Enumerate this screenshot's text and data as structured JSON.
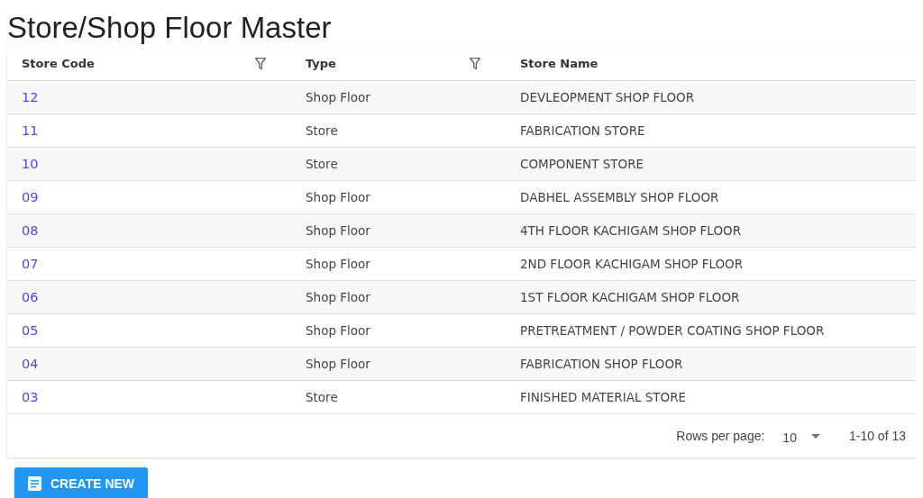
{
  "title": "Store/Shop Floor Master",
  "table": {
    "columns": [
      {
        "label": "Store Code",
        "filter": true
      },
      {
        "label": "Type",
        "filter": true
      },
      {
        "label": "Store Name"
      }
    ],
    "rows": [
      {
        "code": "12",
        "type": "Shop Floor",
        "name": "DEVLEOPMENT SHOP FLOOR"
      },
      {
        "code": "11",
        "type": "Store",
        "name": "FABRICATION STORE"
      },
      {
        "code": "10",
        "type": "Store",
        "name": "COMPONENT STORE"
      },
      {
        "code": "09",
        "type": "Shop Floor",
        "name": "DABHEL ASSEMBLY SHOP FLOOR"
      },
      {
        "code": "08",
        "type": "Shop Floor",
        "name": "4TH FLOOR KACHIGAM SHOP FLOOR"
      },
      {
        "code": "07",
        "type": "Shop Floor",
        "name": "2ND FLOOR KACHIGAM SHOP FLOOR"
      },
      {
        "code": "06",
        "type": "Shop Floor",
        "name": "1ST FLOOR KACHIGAM SHOP FLOOR"
      },
      {
        "code": "05",
        "type": "Shop Floor",
        "name": "PRETREATMENT / POWDER COATING SHOP FLOOR"
      },
      {
        "code": "04",
        "type": "Shop Floor",
        "name": "FABRICATION SHOP FLOOR"
      },
      {
        "code": "03",
        "type": "Store",
        "name": "FINISHED MATERIAL STORE"
      }
    ]
  },
  "pagination": {
    "rows_per_page_label": "Rows per page:",
    "rows_per_page": "10",
    "range": "1-10 of 13"
  },
  "create_button": "CREATE NEW"
}
